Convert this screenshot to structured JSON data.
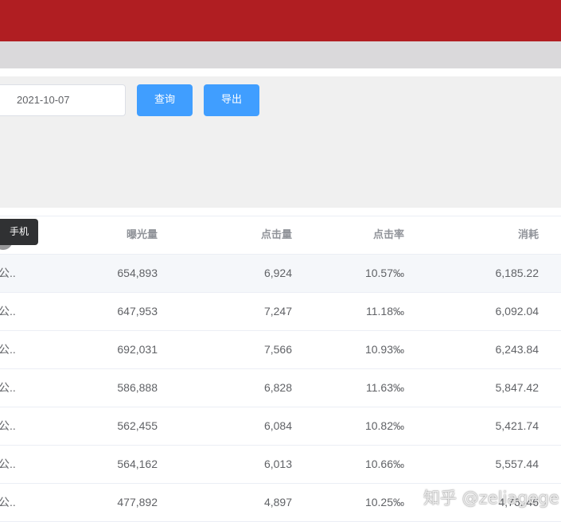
{
  "filter": {
    "date_value": "2021-10-07",
    "query_label": "查询",
    "export_label": "导出"
  },
  "table": {
    "headers": [
      "",
      "曝光量",
      "点击量",
      "点击率",
      "消耗"
    ],
    "rows": [
      [
        "公...",
        "654,893",
        "6,924",
        "10.57‰",
        "6,185.22"
      ],
      [
        "公...",
        "647,953",
        "7,247",
        "11.18‰",
        "6,092.04"
      ],
      [
        "公...",
        "692,031",
        "7,566",
        "10.93‰",
        "6,243.84"
      ],
      [
        "公...",
        "586,888",
        "6,828",
        "11.63‰",
        "5,847.42"
      ],
      [
        "公...",
        "562,455",
        "6,084",
        "10.82‰",
        "5,421.74"
      ],
      [
        "公...",
        "564,162",
        "6,013",
        "10.66‰",
        "5,557.44"
      ],
      [
        "公...",
        "477,892",
        "4,897",
        "10.25‰",
        "4,76..46"
      ]
    ]
  },
  "tooltip": {
    "text": "手机"
  },
  "watermark": {
    "text": "知乎 @zeliagege"
  }
}
